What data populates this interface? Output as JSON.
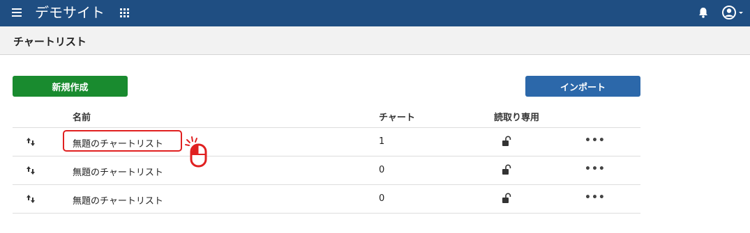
{
  "topbar": {
    "site_title": "デモサイト",
    "icons": [
      "menu-icon",
      "apps-icon",
      "bell-icon",
      "user-icon"
    ]
  },
  "page": {
    "title": "チャートリスト"
  },
  "actions": {
    "new_label": "新規作成",
    "import_label": "インポート"
  },
  "table": {
    "columns": {
      "name": "名前",
      "chart": "チャート",
      "readonly": "読取り専用"
    },
    "rows": [
      {
        "name": "無題のチャートリスト",
        "count": "1",
        "readonly_icon": "unlock-icon",
        "menu_icon": "more-icon"
      },
      {
        "name": "無題のチャートリスト",
        "count": "0",
        "readonly_icon": "unlock-icon",
        "menu_icon": "more-icon"
      },
      {
        "name": "無題のチャートリスト",
        "count": "0",
        "readonly_icon": "unlock-icon",
        "menu_icon": "more-icon"
      }
    ]
  },
  "colors": {
    "topbar": "#1f4e82",
    "new_button": "#198b2f",
    "import_button": "#2c68aa",
    "highlight": "#e02020"
  }
}
